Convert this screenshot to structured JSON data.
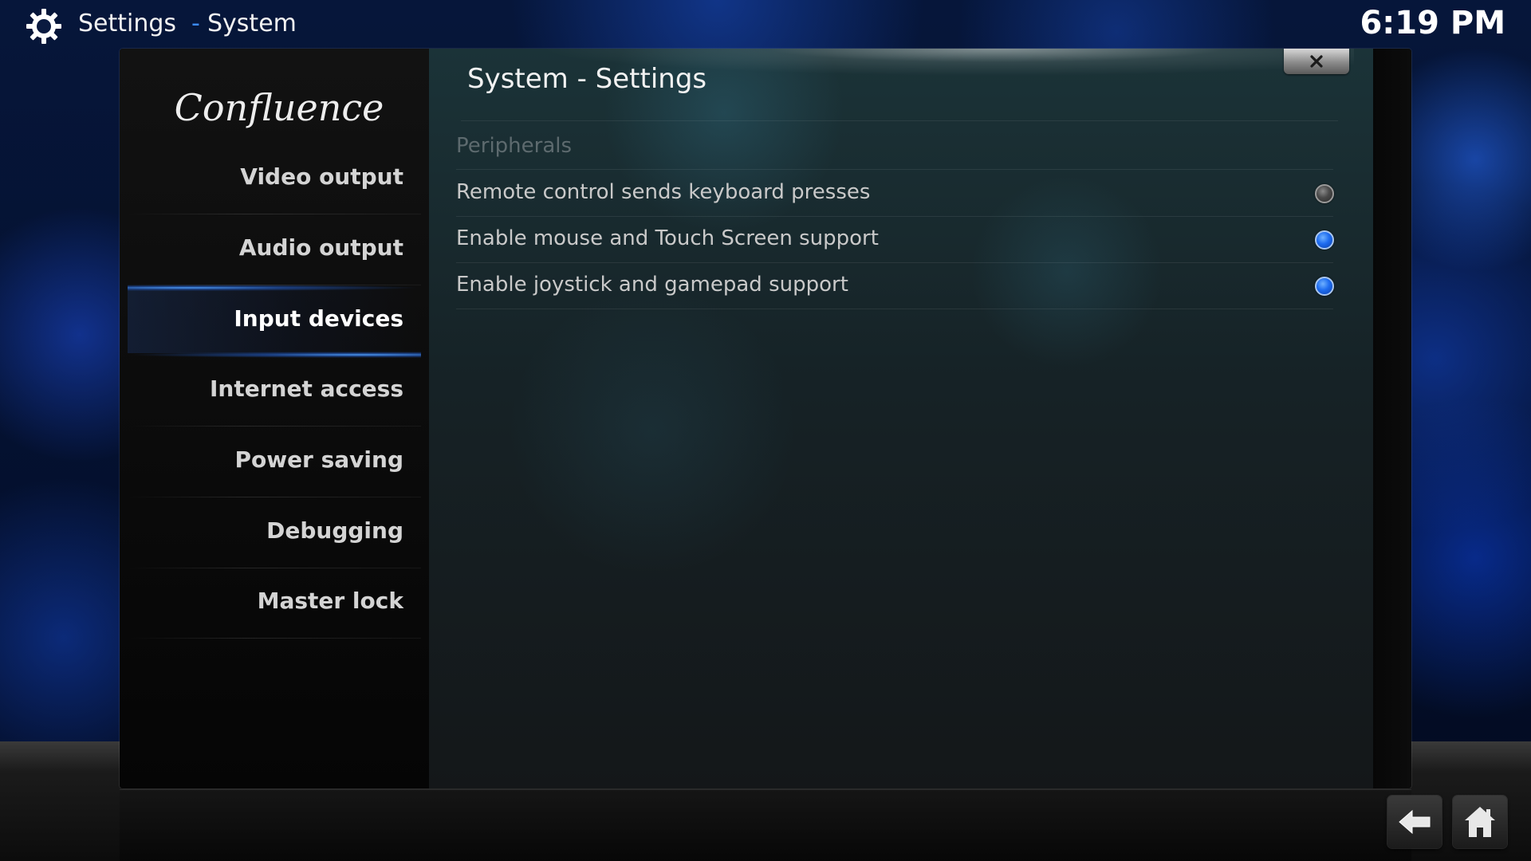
{
  "header": {
    "title": "Settings",
    "separator": "-",
    "subtitle": "System",
    "clock": "6:19 PM"
  },
  "window": {
    "logo_text": "Confluence",
    "title": "System - Settings"
  },
  "sidebar": {
    "items": [
      {
        "label": "Video output"
      },
      {
        "label": "Audio output"
      },
      {
        "label": "Input devices",
        "active": true
      },
      {
        "label": "Internet access"
      },
      {
        "label": "Power saving"
      },
      {
        "label": "Debugging"
      },
      {
        "label": "Master lock"
      }
    ]
  },
  "settings": {
    "section": "Peripherals",
    "rows": [
      {
        "label": "Remote control sends keyboard presses",
        "enabled": false
      },
      {
        "label": "Enable mouse and Touch Screen support",
        "enabled": true
      },
      {
        "label": "Enable joystick and gamepad support",
        "enabled": true
      }
    ]
  },
  "icons": {
    "settings": "gear-icon",
    "close": "close-icon",
    "back": "back-arrow-icon",
    "home": "home-icon"
  },
  "colors": {
    "accent": "#3c8cff",
    "radio_on": "#1e6cf0"
  }
}
